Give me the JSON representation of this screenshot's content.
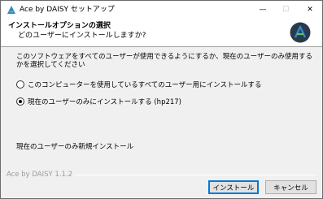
{
  "window": {
    "title": "Ace by DAISY セットアップ",
    "controls": {
      "minimize": "—",
      "maximize": "☐",
      "close": "✕"
    }
  },
  "header": {
    "title": "インストールオプションの選択",
    "subtitle": "どのユーザーにインストールしますか?",
    "logo_icon": "ace-logo-icon"
  },
  "body": {
    "description": "このソフトウェアをすべてのユーザーが使用できるようにするか、現在のユーザーのみ使用するかを選択してください",
    "options": [
      {
        "label": "このコンピューターを使用しているすべてのユーザー用にインストールする",
        "selected": false
      },
      {
        "label": "現在のユーザーのみにインストールする (hp217)",
        "selected": true
      }
    ],
    "status": "現在のユーザーのみ新規インストール"
  },
  "footer": {
    "brand": "Ace by DAISY 1.1.2",
    "install_label": "インストール",
    "cancel_label": "キャンセル"
  },
  "colors": {
    "logo_dark": "#2b3a4a",
    "logo_green": "#5cc46c",
    "logo_blue": "#2f86c8",
    "focus_blue": "#0078d7"
  }
}
